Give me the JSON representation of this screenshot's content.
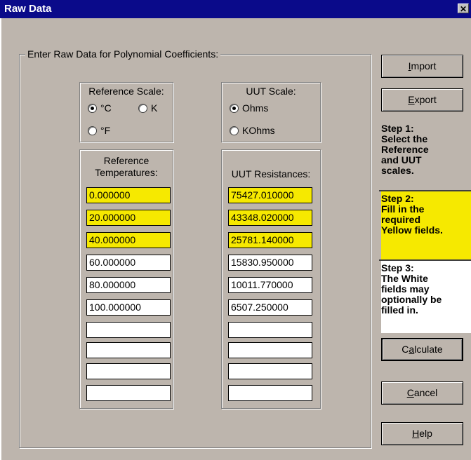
{
  "window": {
    "title": "Raw Data",
    "close_glyph": "✕"
  },
  "group": {
    "legend": "Enter Raw Data for Polynomial Coefficients:"
  },
  "reference_scale": {
    "label": "Reference Scale:",
    "options": [
      {
        "label": "°C",
        "selected": true
      },
      {
        "label": "K",
        "selected": false
      },
      {
        "label": "°F",
        "selected": false
      }
    ]
  },
  "uut_scale": {
    "label": "UUT Scale:",
    "options": [
      {
        "label": "Ohms",
        "selected": true
      },
      {
        "label": "KOhms",
        "selected": false
      }
    ]
  },
  "reference_temps": {
    "label_line1": "Reference",
    "label_line2": "Temperatures:",
    "values": [
      "0.000000",
      "20.000000",
      "40.000000",
      "60.000000",
      "80.000000",
      "100.000000",
      "",
      "",
      "",
      ""
    ]
  },
  "uut_resistances": {
    "label": "UUT Resistances:",
    "values": [
      "75427.010000",
      "43348.020000",
      "25781.140000",
      "15830.950000",
      "10011.770000",
      "6507.250000",
      "",
      "",
      "",
      ""
    ]
  },
  "buttons": {
    "import": {
      "accel": "I",
      "rest": "mport"
    },
    "export": {
      "accel": "E",
      "rest": "xport"
    },
    "calculate": {
      "pre": "C",
      "accel": "a",
      "rest": "lculate"
    },
    "cancel": {
      "accel": "C",
      "rest": "ancel"
    },
    "help": {
      "accel": "H",
      "rest": "elp"
    }
  },
  "steps": {
    "step1": "Step 1:\nSelect the\nReference\nand UUT\nscales.",
    "step2": "Step 2:\nFill in the\nrequired\nYellow fields.",
    "step3": "Step 3:\nThe White\nfields may\noptionally be\nfilled in."
  },
  "colors": {
    "title_bar": "#0a0a8a",
    "dialog_bg": "#bdb5ad",
    "required_field": "#f6e900"
  }
}
